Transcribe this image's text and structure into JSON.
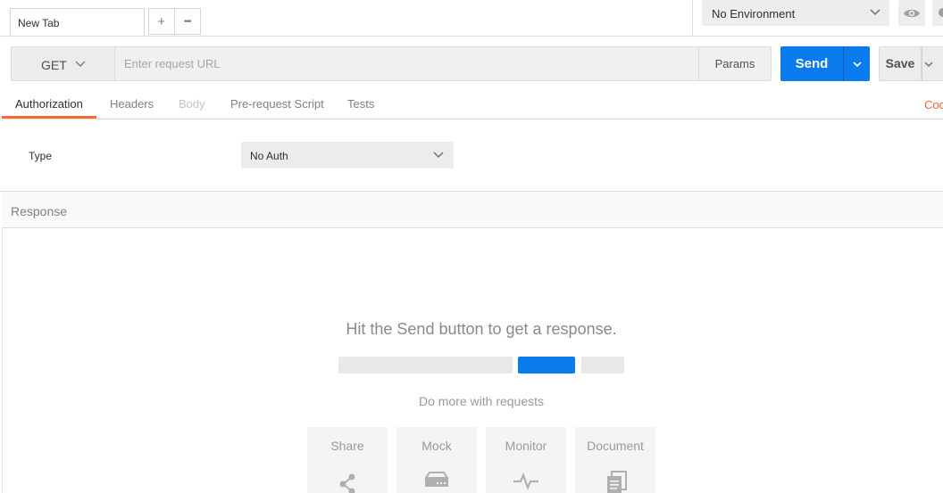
{
  "tabs": {
    "active_tab": "New Tab",
    "add_label": "+",
    "more_label": "•••"
  },
  "environment": {
    "selected": "No Environment"
  },
  "request": {
    "method": "GET",
    "url_placeholder": "Enter request URL",
    "params_label": "Params",
    "send_label": "Send",
    "save_label": "Save"
  },
  "subtabs": {
    "authorization": "Authorization",
    "headers": "Headers",
    "body": "Body",
    "prerequest": "Pre-request Script",
    "tests": "Tests",
    "code": "Cod"
  },
  "auth": {
    "type_label": "Type",
    "type_value": "No Auth"
  },
  "response": {
    "title": "Response",
    "hint": "Hit the Send button to get a response.",
    "more_title": "Do more with requests",
    "features": [
      "Share",
      "Mock",
      "Monitor",
      "Document"
    ]
  },
  "colors": {
    "accent": "#f26b3a",
    "primary": "#097bed"
  }
}
